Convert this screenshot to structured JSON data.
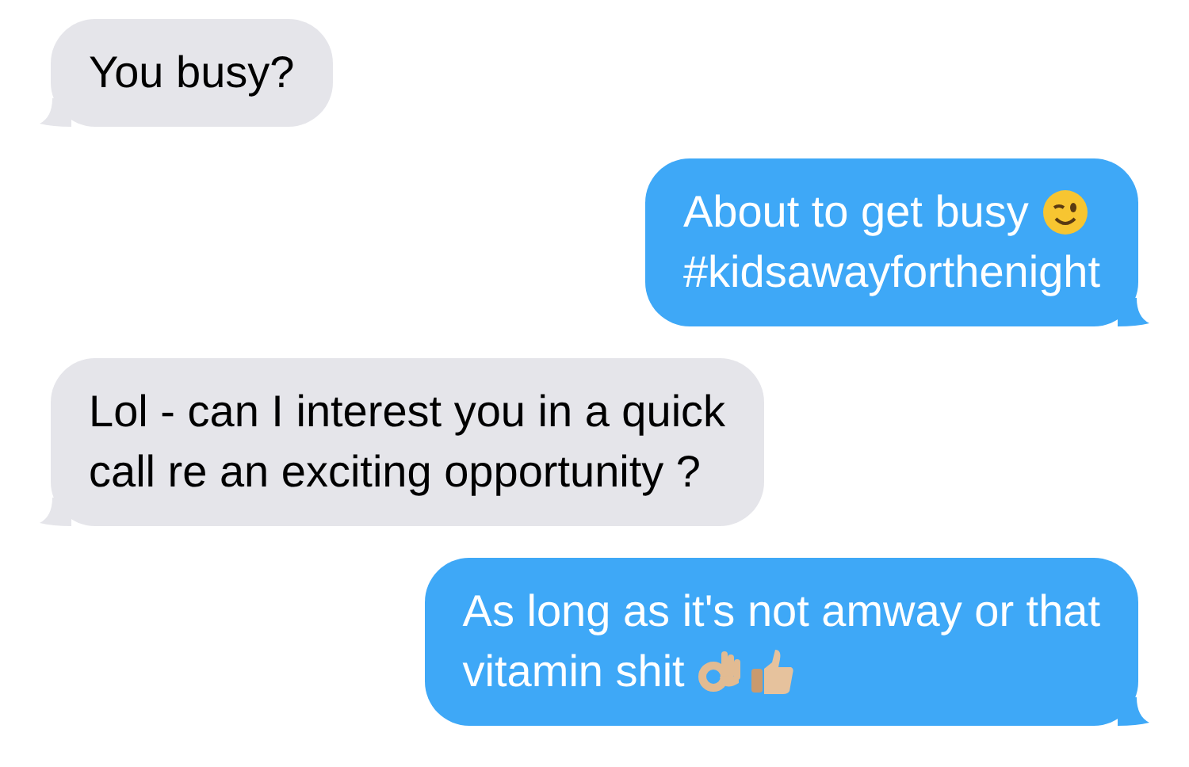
{
  "messages": [
    {
      "kind": "received",
      "lines": [
        {
          "text": "You busy?"
        }
      ]
    },
    {
      "kind": "sent",
      "lines": [
        {
          "text": "About to get busy",
          "icons": [
            {
              "kind": "wink"
            }
          ]
        },
        {
          "text": "#kidsawayforthenight"
        }
      ]
    },
    {
      "kind": "received",
      "lines": [
        {
          "text": "Lol - can I interest you in a quick"
        },
        {
          "text": "call re an exciting opportunity ?"
        }
      ]
    },
    {
      "kind": "sent",
      "lines": [
        {
          "text": "As long as it's not amway or that"
        },
        {
          "text": "vitamin shit",
          "icons": [
            {
              "kind": "ok_hand"
            },
            {
              "kind": "thumbs_up"
            }
          ]
        }
      ]
    }
  ]
}
